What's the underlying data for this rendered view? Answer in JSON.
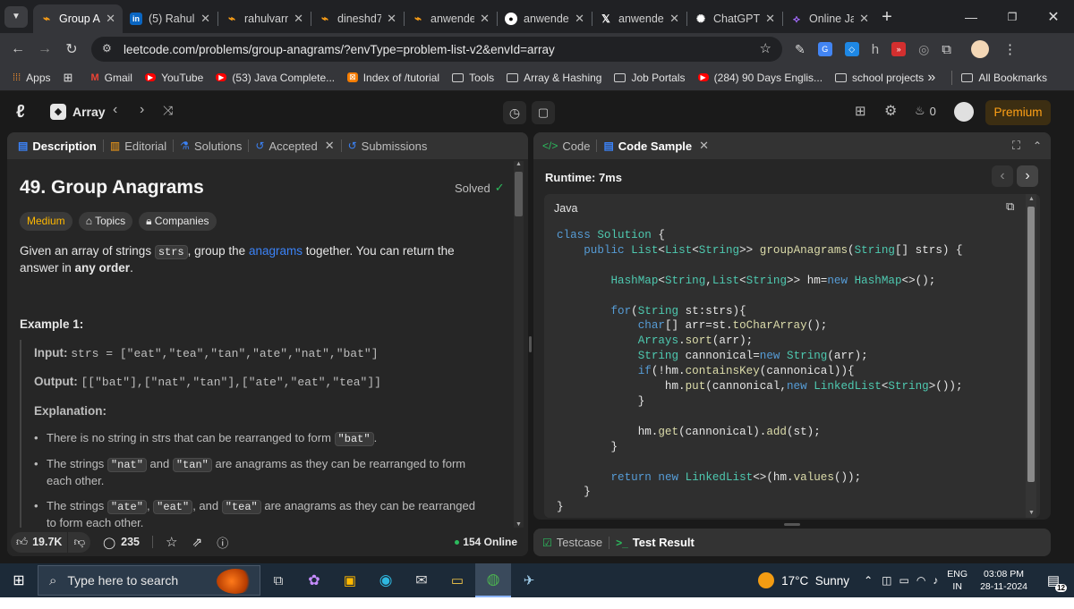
{
  "browser": {
    "tabs": [
      {
        "label": "Group An",
        "active": true,
        "icon": "leetcode-icon"
      },
      {
        "label": "(5) Rahul",
        "icon": "linkedin-icon"
      },
      {
        "label": "rahulvarm",
        "icon": "leetcode-icon"
      },
      {
        "label": "dineshd7",
        "icon": "leetcode-icon"
      },
      {
        "label": "anwende",
        "icon": "leetcode-icon"
      },
      {
        "label": "anwende",
        "icon": "github-icon"
      },
      {
        "label": "anwende",
        "icon": "x-icon"
      },
      {
        "label": "ChatGPT",
        "icon": "chatgpt-icon"
      },
      {
        "label": "Online Jav",
        "icon": "online-java-icon"
      }
    ],
    "url": "leetcode.com/problems/group-anagrams/?envType=problem-list-v2&envId=array",
    "bookmarks": [
      {
        "label": "Apps",
        "icon": "apps-grid-icon"
      },
      {
        "label": "",
        "icon": "grid-icon"
      },
      {
        "label": "Gmail",
        "icon": "gmail-icon"
      },
      {
        "label": "YouTube",
        "icon": "youtube-icon"
      },
      {
        "label": "(53) Java Complete...",
        "icon": "youtube-icon"
      },
      {
        "label": "Index of /tutorial",
        "icon": "index-icon"
      },
      {
        "label": "Tools",
        "icon": "folder-icon"
      },
      {
        "label": "Array & Hashing",
        "icon": "folder-icon"
      },
      {
        "label": "Job Portals",
        "icon": "folder-icon"
      },
      {
        "label": "(284) 90 Days Englis...",
        "icon": "youtube-icon"
      },
      {
        "label": "school projects",
        "icon": "folder-icon"
      }
    ],
    "more_bookmarks": "»",
    "all_bookmarks": "All Bookmarks"
  },
  "header": {
    "list_name": "Array",
    "streak_count": "0",
    "premium_label": "Premium"
  },
  "left_panel": {
    "tabs": [
      {
        "label": "Description",
        "active": true
      },
      {
        "label": "Editorial"
      },
      {
        "label": "Solutions"
      },
      {
        "label": "Accepted"
      },
      {
        "label": "Submissions"
      }
    ],
    "title": "49. Group Anagrams",
    "solved_label": "Solved",
    "tags": {
      "difficulty": "Medium",
      "topics": "Topics",
      "companies": "Companies"
    },
    "description": {
      "p1": "Given an array of strings ",
      "code1": "strs",
      "p2": ", group the ",
      "link": "anagrams",
      "p3": " together. You can return the answer in ",
      "bold": "any order",
      "p4": "."
    },
    "example_title": "Example 1:",
    "input_label": "Input:",
    "input_value": "strs = [\"eat\",\"tea\",\"tan\",\"ate\",\"nat\",\"bat\"]",
    "output_label": "Output:",
    "output_value": "[[\"bat\"],[\"nat\",\"tan\"],[\"ate\",\"eat\",\"tea\"]]",
    "explanation_label": "Explanation:",
    "bullets": {
      "b1_text": "There is no string in strs that can be rearranged to form ",
      "b1_code": "\"bat\"",
      "b1_end": ".",
      "b2_pre": "The strings ",
      "b2_code1": "\"nat\"",
      "b2_mid": " and ",
      "b2_code2": "\"tan\"",
      "b2_end": " are anagrams as they can be rearranged to form each other.",
      "b3_pre": "The strings ",
      "b3_code1": "\"ate\"",
      "b3_sep1": ", ",
      "b3_code2": "\"eat\"",
      "b3_sep2": ", and ",
      "b3_code3": "\"tea\"",
      "b3_end": " are anagrams as they can be rearranged to form each other."
    },
    "footer": {
      "likes": "19.7K",
      "comments": "235",
      "online": "154 Online"
    }
  },
  "right_panel": {
    "tabs": [
      {
        "label": "Code"
      },
      {
        "label": "Code Sample",
        "active": true
      }
    ],
    "runtime": "Runtime: 7ms",
    "language": "Java",
    "code_lines": [
      "class Solution {",
      "    public List<List<String>> groupAnagrams(String[] strs) {",
      "",
      "        HashMap<String,List<String>> hm=new HashMap<>();",
      "",
      "        for(String st:strs){",
      "            char[] arr=st.toCharArray();",
      "            Arrays.sort(arr);",
      "            String cannonical=new String(arr);",
      "            if(!hm.containsKey(cannonical)){",
      "                hm.put(cannonical,new LinkedList<String>());",
      "            }",
      "",
      "            hm.get(cannonical).add(st);",
      "        }",
      "",
      "        return new LinkedList<>(hm.values());",
      "    }",
      "}"
    ],
    "bottom_tabs": [
      {
        "label": "Testcase"
      },
      {
        "label": "Test Result"
      }
    ]
  },
  "taskbar": {
    "search_placeholder": "Type here to search",
    "weather": "17°C  Sunny",
    "lang1": "ENG",
    "lang2": "IN",
    "time": "03:08 PM",
    "date": "28-11-2024",
    "notification_count": "12"
  },
  "colors": {
    "accent": "#ffa116",
    "link": "#3b82f6",
    "medium": "#ffb800",
    "solved": "#2cbb5d"
  }
}
